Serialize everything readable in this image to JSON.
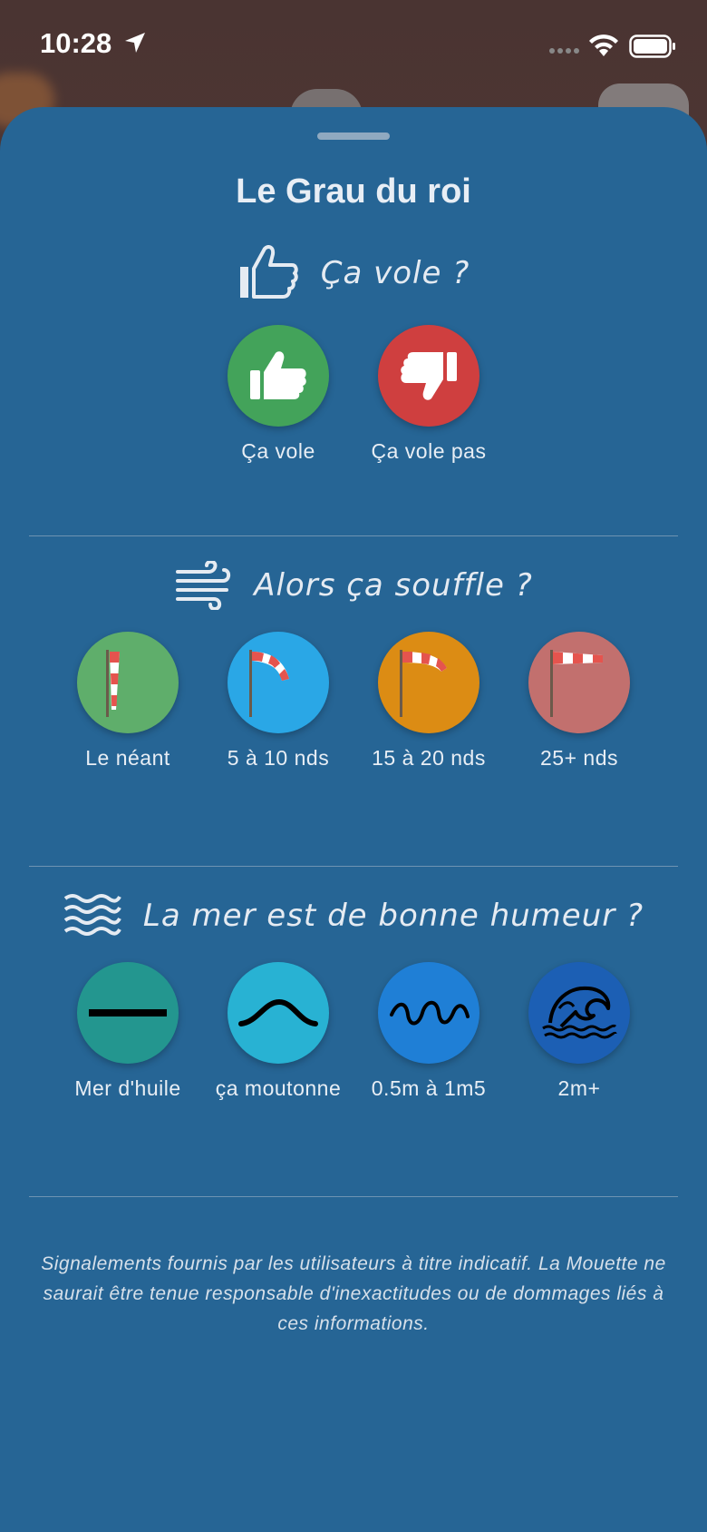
{
  "status": {
    "time": "10:28"
  },
  "sheet": {
    "title": "Le Grau du roi"
  },
  "flying": {
    "heading": "Ça vole ?",
    "choices": [
      {
        "label": "Ça vole",
        "color": "#43a35a",
        "icon": "thumbs-up-icon"
      },
      {
        "label": "Ça vole pas",
        "color": "#cf3f3f",
        "icon": "thumbs-down-icon"
      }
    ]
  },
  "wind": {
    "heading": "Alors ça souffle ?",
    "choices": [
      {
        "label": "Le néant",
        "color": "#5fae6b",
        "icon": "windsock-limp-icon"
      },
      {
        "label": "5 à 10 nds",
        "color": "#2aa7e6",
        "icon": "windsock-light-icon"
      },
      {
        "label": "15 à 20 nds",
        "color": "#dc8c14",
        "icon": "windsock-medium-icon"
      },
      {
        "label": "25+ nds",
        "color": "#c2706e",
        "icon": "windsock-full-icon"
      }
    ]
  },
  "sea": {
    "heading": "La mer est de bonne humeur ?",
    "choices": [
      {
        "label": "Mer d'huile",
        "color": "#23968f",
        "icon": "flat-line-icon"
      },
      {
        "label": "ça moutonne",
        "color": "#28b2d3",
        "icon": "small-wave-icon"
      },
      {
        "label": "0.5m à 1m5",
        "color": "#1f7fd6",
        "icon": "choppy-wave-icon"
      },
      {
        "label": "2m+",
        "color": "#1c5fb4",
        "icon": "big-wave-icon"
      }
    ]
  },
  "disclaimer": "Signalements fournis par les utilisateurs à titre indicatif. La Mouette ne saurait être tenue responsable d'inexactitudes ou de dommages liés à ces informations."
}
